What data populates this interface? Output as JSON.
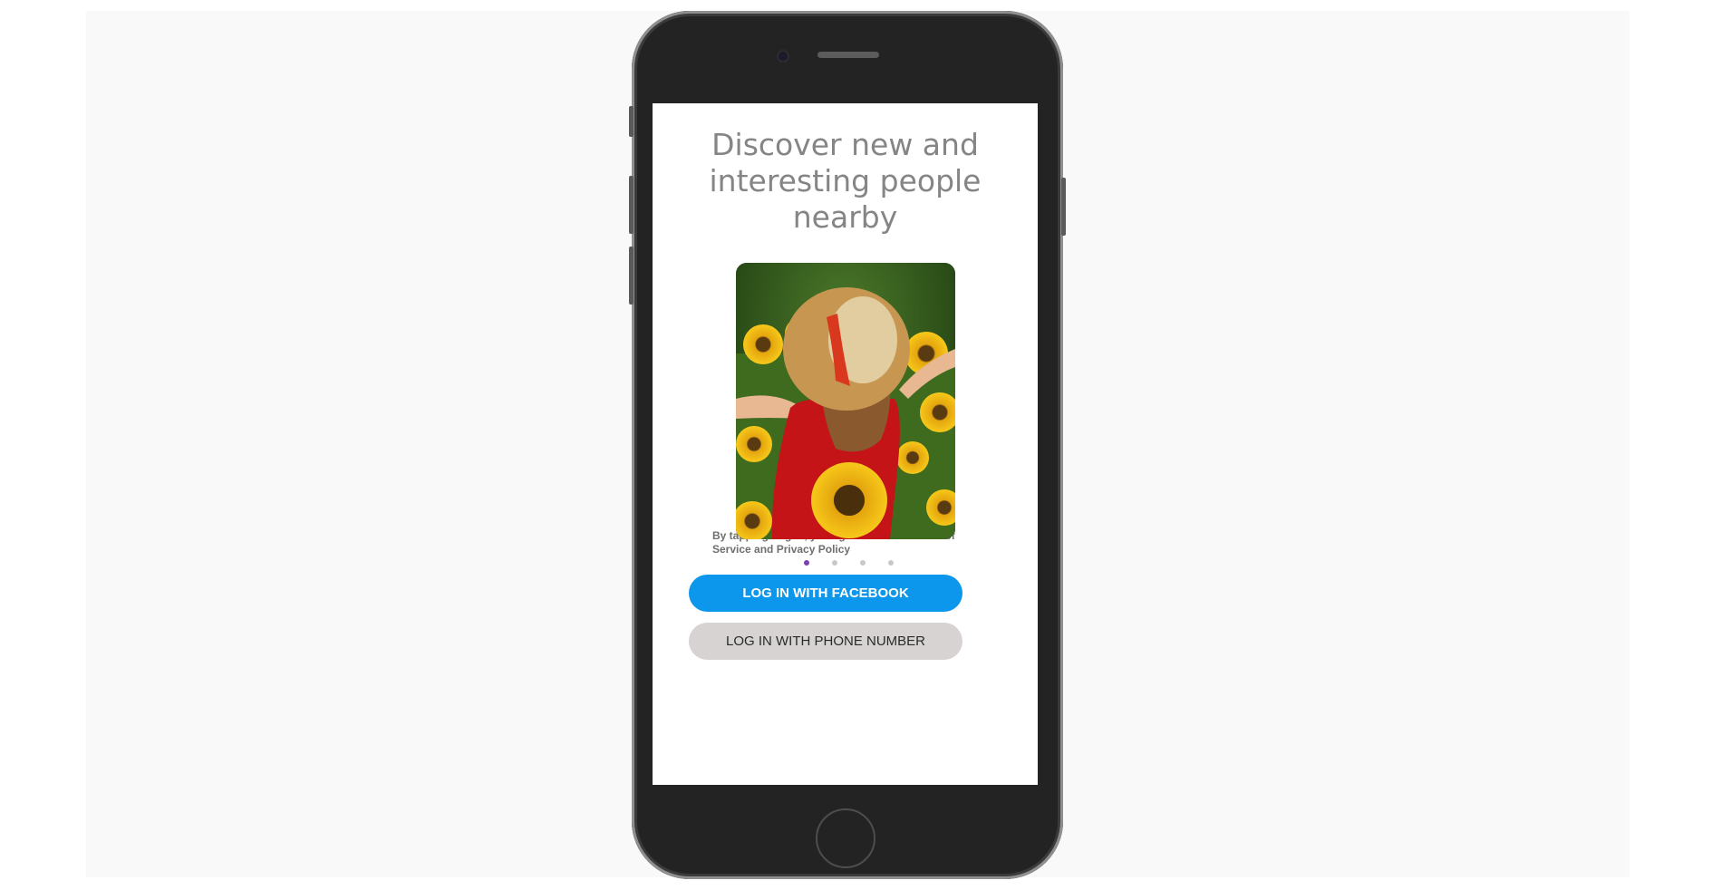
{
  "onboarding": {
    "headline": "Discover new and interesting people nearby",
    "legal_text": "By ta… s of Service and Privacy Policy",
    "legal_line1": "By tapping Log In, you agree with our Terms of",
    "legal_line2": "Service and Privacy Policy",
    "carousel": {
      "slide_count": 4,
      "active_index": 0,
      "photo_description_icon": "woman-sunflower-field-photo"
    },
    "buttons": {
      "facebook_label": "LOG IN WITH FACEBOOK",
      "phone_label": "LOG IN WITH PHONE NUMBER"
    }
  },
  "colors": {
    "facebook_button": "#0c96ec",
    "phone_button": "#d7d3d3",
    "active_dot": "#7b3fb0",
    "headline_text": "#858585"
  }
}
